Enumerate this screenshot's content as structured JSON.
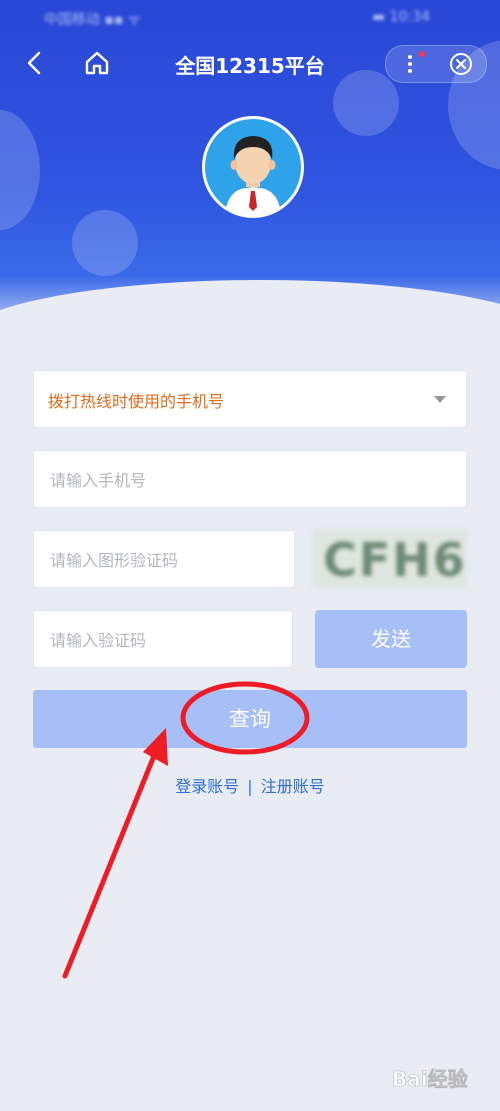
{
  "status_bar": {
    "carrier": "中国移动 ▪▪ ᯤ",
    "right": "▬ 10:34"
  },
  "nav": {
    "title": "全国12315平台"
  },
  "form": {
    "phone_type_value": "拨打热线时使用的手机号",
    "phone_placeholder": "请输入手机号",
    "captcha_placeholder": "请输入图形验证码",
    "captcha_text": "CFH6",
    "code_placeholder": "请输入验证码",
    "send_label": "发送",
    "query_label": "查询"
  },
  "links": {
    "login": "登录账号",
    "separator": "|",
    "register": "注册账号"
  },
  "watermark": {
    "text": "Bai经验"
  },
  "colors": {
    "header_blue": "#2a47d6",
    "accent_orange": "#e06b1b",
    "button_light_blue": "#a6c0f7",
    "link_blue": "#2f6fd6",
    "annotation_red": "#ee1c24"
  }
}
